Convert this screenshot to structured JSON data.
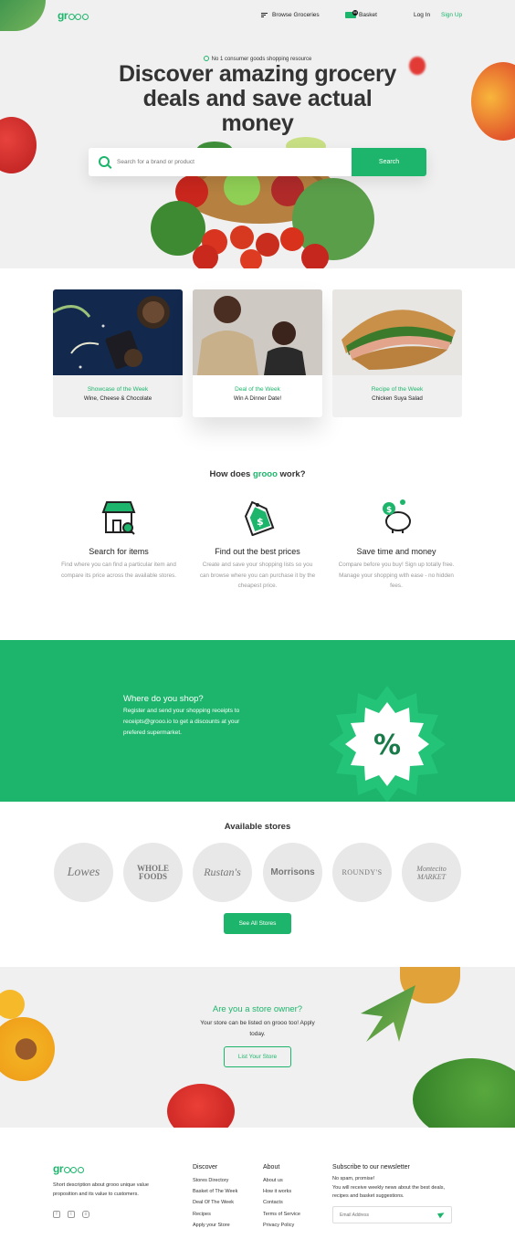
{
  "header": {
    "logo": "grooo",
    "browse_label": "Browse Groceries",
    "basket_label": "Basket",
    "basket_count": "99",
    "login_label": "Log In",
    "signup_label": "Sign Up"
  },
  "hero": {
    "tagline": "No 1 consumer goods shopping resource",
    "headline": "Discover amazing grocery deals and save actual money",
    "search_placeholder": "Search for a brand or product",
    "search_button": "Search"
  },
  "feature_cards": [
    {
      "kicker": "Showcase of the Week",
      "title": "Wine, Cheese & Chocolate"
    },
    {
      "kicker": "Deal of the Week",
      "title": "Win A Dinner Date!"
    },
    {
      "kicker": "Recipe of the Week",
      "title": "Chicken Suya Salad"
    }
  ],
  "how": {
    "title_prefix": "How does ",
    "title_brand": "grooo",
    "title_suffix": " work?",
    "steps": [
      {
        "title": "Search for items",
        "desc": "Find where you can find a particular item and compare its price across the available stores."
      },
      {
        "title": "Find out the best prices",
        "desc": "Create and save your shopping lists so you can browse where you can purchase it by the cheapest price."
      },
      {
        "title": "Save time and money",
        "desc": "Compare before you buy! Sign up totally free. Manage your shopping with ease - no hidden fees."
      }
    ]
  },
  "band": {
    "title": "Where do you shop?",
    "text": "Register and send your shopping receipts to receipts@grooo.io to get a discounts at your prefered supermarket.",
    "badge_symbol": "%"
  },
  "stores": {
    "title": "Available stores",
    "items": [
      "Lowes",
      "WHOLE FOODS",
      "Rustan's",
      "Morrisons",
      "ROUNDY'S",
      "Montecito MARKET"
    ],
    "see_all": "See All Stores"
  },
  "owner": {
    "title": "Are you a store owner?",
    "text": "Your store can be listed on grooo too! Apply today.",
    "button": "List Your Store"
  },
  "footer": {
    "logo": "grooo",
    "desc": "Short description about grooo unique value proposition and its value to customers.",
    "discover": {
      "title": "Discover",
      "links": [
        "Stores Directory",
        "Basket of The Week",
        "Deal Of The Week",
        "Recipes",
        "Apply your Store"
      ]
    },
    "about": {
      "title": "About",
      "links": [
        "About us",
        "How it works",
        "Contacts",
        "Terms of Service",
        "Privacy Policy"
      ]
    },
    "newsletter": {
      "title": "Subscribe to our newsletter",
      "note1": "No spam, promise!",
      "note2": "You will receive weekly news about the best deals, recipes and basket suggestions.",
      "email_placeholder": "Email Address"
    }
  },
  "colors": {
    "brand": "#1db56b",
    "text": "#222222",
    "muted": "#999999",
    "bg": "#f0f0f0"
  }
}
